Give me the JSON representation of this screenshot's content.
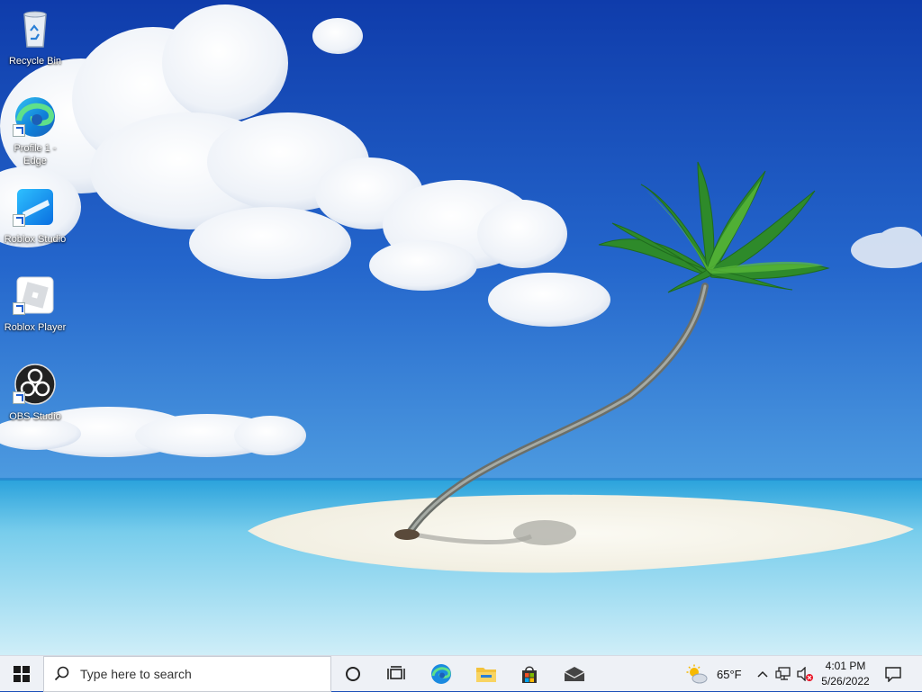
{
  "desktop": {
    "icons": [
      {
        "label": "Recycle Bin",
        "icon": "recycle-bin-icon"
      },
      {
        "label": "Profile 1 - Edge",
        "icon": "edge-icon"
      },
      {
        "label": "Roblox Studio",
        "icon": "roblox-studio-icon"
      },
      {
        "label": "Roblox Player",
        "icon": "roblox-player-icon"
      },
      {
        "label": "OBS Studio",
        "icon": "obs-studio-icon"
      }
    ]
  },
  "taskbar": {
    "search_placeholder": "Type here to search",
    "pinned": [
      "cortana-icon",
      "task-view-icon",
      "edge-icon",
      "file-explorer-icon",
      "microsoft-store-icon",
      "mail-icon"
    ],
    "weather": {
      "temperature": "65°F",
      "icon": "partly-sunny-icon"
    },
    "clock": {
      "time": "4:01 PM",
      "date": "5/26/2022"
    }
  },
  "colors": {
    "sky_top": "#1240b0",
    "sea": "#5ec2e6",
    "sand": "#f4f1e4",
    "taskbar": "#eef1f6"
  }
}
